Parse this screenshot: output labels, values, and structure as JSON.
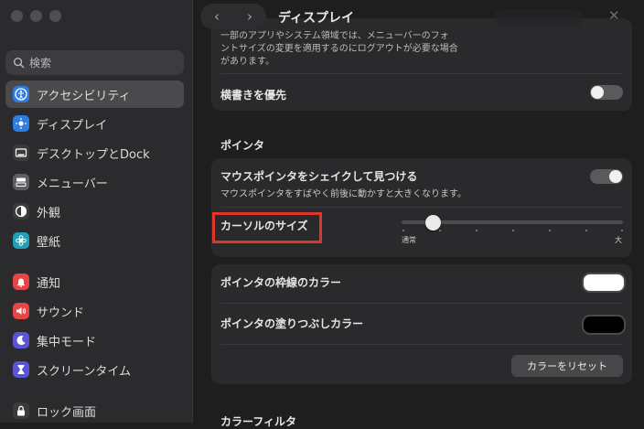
{
  "sidebar": {
    "search_placeholder": "検索",
    "items": [
      {
        "label": "アクセシビリティ",
        "icon": "accessibility-icon",
        "color": "#2f7de1",
        "selected": true
      },
      {
        "label": "ディスプレイ",
        "icon": "display-icon",
        "color": "#2f7de1"
      },
      {
        "label": "デスクトップとDock",
        "icon": "desktop-dock-icon",
        "color": "#3b3b3e"
      },
      {
        "label": "メニューバー",
        "icon": "menubar-icon",
        "color": "#5e5e62"
      },
      {
        "label": "外観",
        "icon": "appearance-icon",
        "color": "#3b3b3e"
      },
      {
        "label": "壁紙",
        "icon": "wallpaper-icon",
        "color": "#1fa0b5"
      },
      {
        "label": "通知",
        "icon": "bell-icon",
        "color": "#e64545"
      },
      {
        "label": "サウンド",
        "icon": "speaker-icon",
        "color": "#e64545"
      },
      {
        "label": "集中モード",
        "icon": "moon-icon",
        "color": "#5a55d6"
      },
      {
        "label": "スクリーンタイム",
        "icon": "hourglass-icon",
        "color": "#5a55d6"
      },
      {
        "label": "ロック画面",
        "icon": "lock-icon",
        "color": "#3b3b3e"
      }
    ]
  },
  "header": {
    "back": "‹",
    "forward": "›",
    "title": "ディスプレイ"
  },
  "content": {
    "top_text_line1": "一部のアプリやシステム領域では、メニューバーのフォ",
    "top_text_line2": "ントサイズの変更を適用するのにログアウトが必要な場合",
    "top_text_line3": "があります。",
    "vertical_text_label": "横書きを優先",
    "vertical_text_toggle_on": false,
    "pointer_section_title": "ポインタ",
    "shake_title": "マウスポインタをシェイクして見つける",
    "shake_subtitle": "マウスポインタをすばやく前後に動かすと大きくなります。",
    "shake_toggle_on": true,
    "cursor_size_label": "カーソルのサイズ",
    "cursor_size_min_label": "通常",
    "cursor_size_max_label": "大",
    "cursor_size_value": 0.15,
    "outline_color_label": "ポインタの枠線のカラー",
    "outline_color": "#ffffff",
    "fill_color_label": "ポインタの塗りつぶしカラー",
    "fill_color": "#000000",
    "reset_button": "カラーをリセット",
    "color_filter_section_title": "カラーフィルタ"
  }
}
